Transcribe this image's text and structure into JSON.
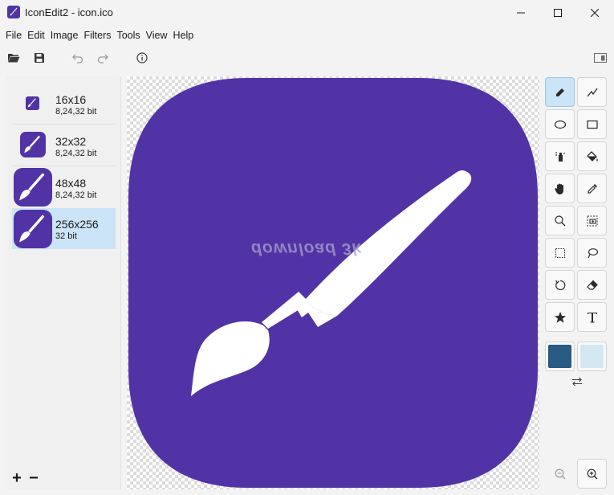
{
  "window": {
    "title": "IconEdit2 - icon.ico"
  },
  "menu": {
    "items": [
      "File",
      "Edit",
      "Image",
      "Filters",
      "Tools",
      "View",
      "Help"
    ]
  },
  "toolbar": {
    "icons": [
      "open-folder-icon",
      "save-icon",
      "undo-icon",
      "redo-icon",
      "info-icon",
      "panel-toggle-icon"
    ]
  },
  "sizes": [
    {
      "name": "16x16",
      "bits": "8,24,32 bit"
    },
    {
      "name": "32x32",
      "bits": "8,24,32 bit"
    },
    {
      "name": "48x48",
      "bits": "8,24,32 bit"
    },
    {
      "name": "256x256",
      "bits": "32 bit",
      "selected": true
    }
  ],
  "panel_buttons": {
    "add": "+",
    "remove": "−"
  },
  "canvas": {
    "icon_color": "#5133a6",
    "watermark": "download 3k"
  },
  "tools": [
    "pencil-icon",
    "line-icon",
    "ellipse-icon",
    "rectangle-icon",
    "spray-icon",
    "fill-bucket-icon",
    "hand-icon",
    "color-picker-icon",
    "zoom-icon",
    "screen-capture-icon",
    "rectangle-select-icon",
    "lasso-icon",
    "rotate-icon",
    "eraser-icon",
    "star-icon",
    "text-icon"
  ],
  "colors": {
    "primary": "#285a82",
    "secondary": "#d4e8f4"
  },
  "zoom": {
    "out": "zoom-out-icon",
    "in": "zoom-in-icon"
  }
}
